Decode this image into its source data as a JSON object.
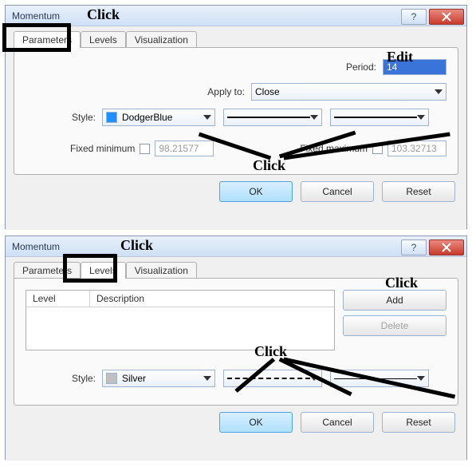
{
  "dialog1": {
    "title": "Momentum",
    "tabs": {
      "parameters": "Parameters",
      "levels": "Levels",
      "visualization": "Visualization"
    },
    "period_label": "Period:",
    "period_value": "14",
    "apply_label": "Apply to:",
    "apply_value": "Close",
    "style_label": "Style:",
    "style_value": "DodgerBlue",
    "style_color": "#1e90ff",
    "fixed_min_label": "Fixed minimum",
    "fixed_min_value": "98.21577",
    "fixed_max_label": "Fixed maximum",
    "fixed_max_value": "103.32713",
    "buttons": {
      "ok": "OK",
      "cancel": "Cancel",
      "reset": "Reset"
    },
    "annot_click_tab": "Click",
    "annot_edit": "Edit",
    "annot_click_combos": "Click"
  },
  "dialog2": {
    "title": "Momentum",
    "tabs": {
      "parameters": "Parameters",
      "levels": "Levels",
      "visualization": "Visualization"
    },
    "col_level": "Level",
    "col_desc": "Description",
    "add_label": "Add",
    "delete_label": "Delete",
    "style_label": "Style:",
    "style_value": "Silver",
    "style_color": "#c0c0c0",
    "buttons": {
      "ok": "OK",
      "cancel": "Cancel",
      "reset": "Reset"
    },
    "annot_click_tab": "Click",
    "annot_click_add": "Click",
    "annot_click_combos": "Click"
  }
}
